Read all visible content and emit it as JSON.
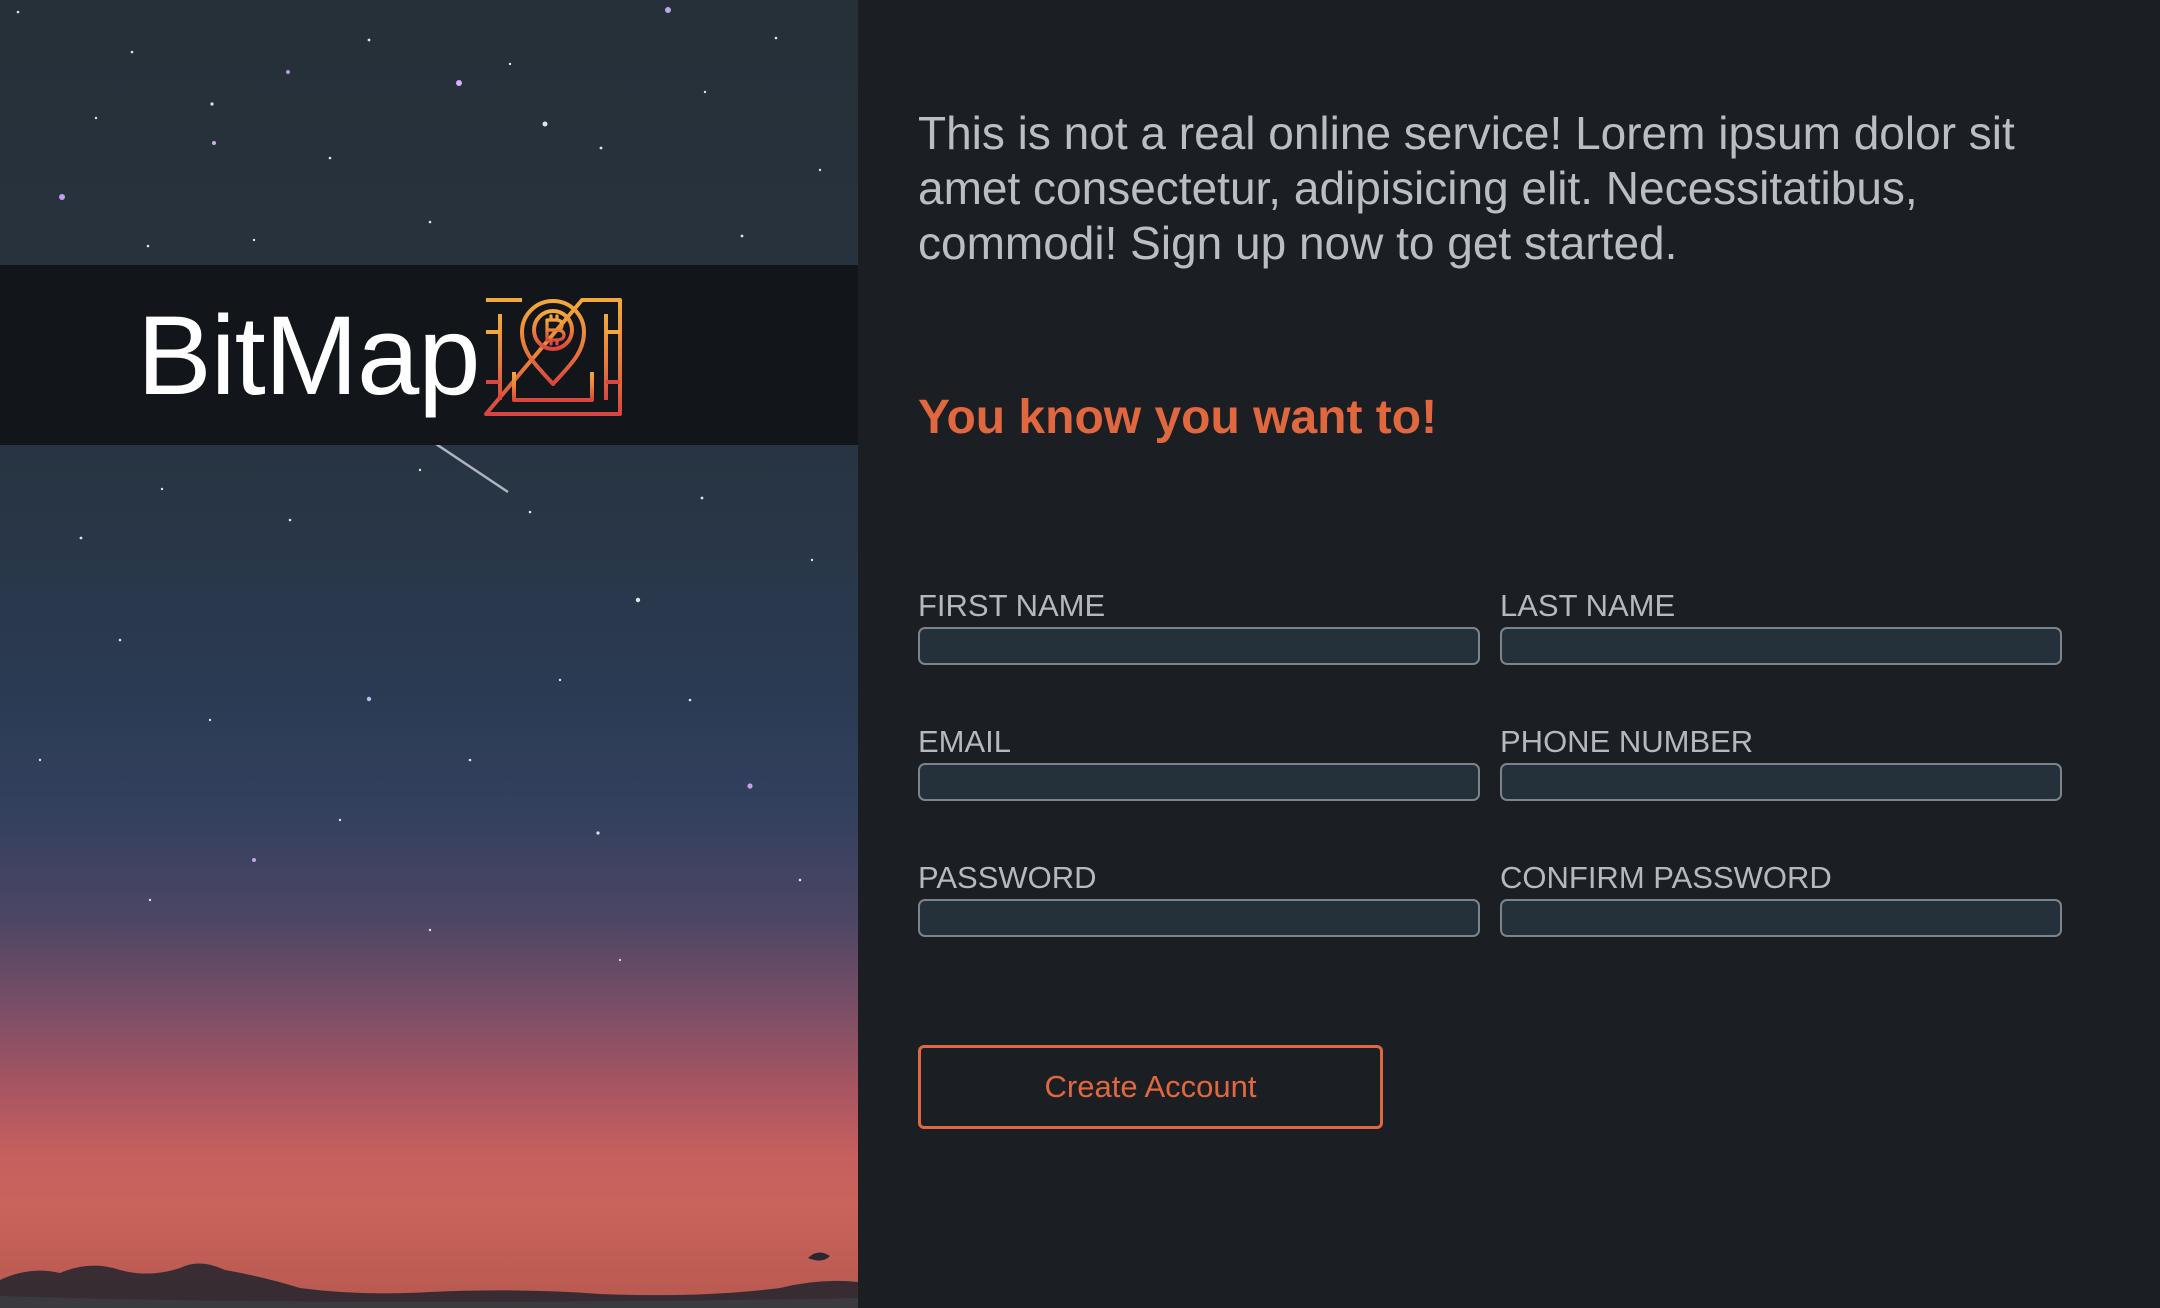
{
  "brand": {
    "name": "BitMap",
    "icon": "bitcoin-map-pin-icon",
    "icon_colors": [
      "#f2a93b",
      "#e0673e",
      "#d9463f"
    ]
  },
  "hero": {
    "background": "night-sky-stars-sunset-photo"
  },
  "intro_text": "This is not a real online service! Lorem ipsum dolor sit amet consectetur, adipisicing elit. Necessitatibus, commodi! Sign up now to get started.",
  "tagline": "You know you want to!",
  "form": {
    "first_name": {
      "label": "FIRST NAME",
      "value": ""
    },
    "last_name": {
      "label": "LAST NAME",
      "value": ""
    },
    "email": {
      "label": "EMAIL",
      "value": ""
    },
    "phone": {
      "label": "PHONE NUMBER",
      "value": ""
    },
    "password": {
      "label": "PASSWORD",
      "value": ""
    },
    "confirm_password": {
      "label": "CONFIRM PASSWORD",
      "value": ""
    },
    "submit_label": "Create Account"
  },
  "colors": {
    "accent": "#e0673e",
    "panel_bg": "#1b1f24",
    "text_muted": "#b9bec2",
    "input_bg": "#24303a"
  }
}
